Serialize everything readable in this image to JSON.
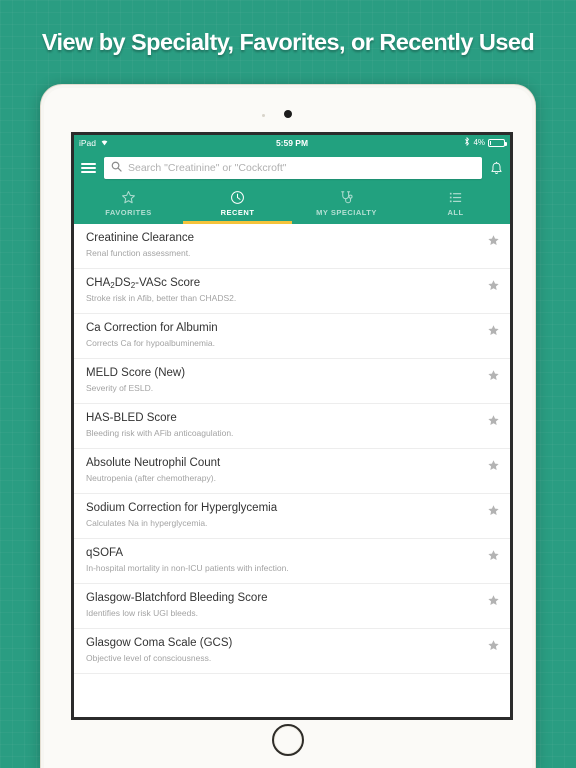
{
  "headline": "View by Specialty, Favorites, or Recently Used",
  "colors": {
    "backdrop_teal": "#2a9d82",
    "app_green": "#22a17f",
    "active_tab_underline": "#f5c33b",
    "star_gray": "#b3b3b3",
    "title_text": "#333333",
    "subtitle_text": "#a3a3a3"
  },
  "device": {
    "type": "iPad",
    "camera_icon": "camera-dot-icon",
    "home_button_icon": "home-button-icon"
  },
  "status_bar": {
    "carrier": "iPad",
    "wifi_icon": "wifi-icon",
    "time": "5:59 PM",
    "bluetooth_icon": "bluetooth-icon",
    "battery_percent": "4%",
    "battery_icon": "battery-icon"
  },
  "app_bar": {
    "menu_icon": "hamburger-menu-icon",
    "search_icon": "search-icon",
    "search_value": "",
    "search_placeholder": "Search \"Creatinine\" or \"Cockcroft\"",
    "bell_icon": "bell-icon"
  },
  "tabs": [
    {
      "label": "FAVORITES",
      "icon": "star-outline-icon",
      "active": false
    },
    {
      "label": "RECENT",
      "icon": "clock-icon",
      "active": true
    },
    {
      "label": "MY SPECIALTY",
      "icon": "stethoscope-icon",
      "active": false
    },
    {
      "label": "ALL",
      "icon": "list-icon",
      "active": false
    }
  ],
  "list": {
    "star_icon": "star-filled-icon",
    "items": [
      {
        "title": "Creatinine Clearance",
        "subtitle": "Renal function assessment."
      },
      {
        "title": "CHA2DS2-VASc Score",
        "title_html": "CHA<sub>2</sub>DS<sub>2</sub>-VASc Score",
        "subtitle": "Stroke risk in Afib, better than CHADS2."
      },
      {
        "title": "Ca Correction for Albumin",
        "subtitle": "Corrects Ca for hypoalbuminemia."
      },
      {
        "title": "MELD Score (New)",
        "subtitle": "Severity of ESLD."
      },
      {
        "title": "HAS-BLED Score",
        "subtitle": "Bleeding risk with AFib anticoagulation."
      },
      {
        "title": "Absolute Neutrophil Count",
        "subtitle": "Neutropenia (after chemotherapy)."
      },
      {
        "title": "Sodium Correction for Hyperglycemia",
        "subtitle": "Calculates Na in hyperglycemia."
      },
      {
        "title": "qSOFA",
        "subtitle": "In-hospital mortality in non-ICU patients with infection."
      },
      {
        "title": "Glasgow-Blatchford Bleeding Score",
        "subtitle": "Identifies low risk UGI bleeds."
      },
      {
        "title": "Glasgow Coma Scale (GCS)",
        "subtitle": "Objective level of consciousness."
      }
    ]
  }
}
